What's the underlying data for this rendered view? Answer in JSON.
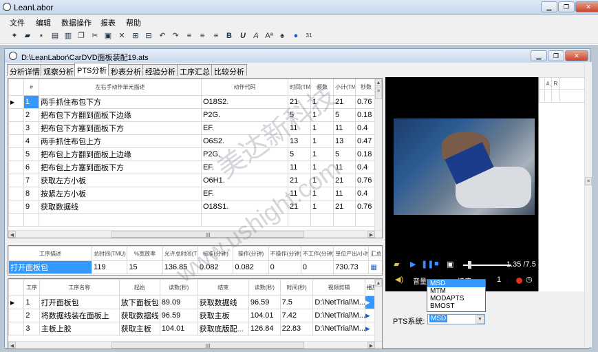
{
  "app": {
    "title": "LeanLabor"
  },
  "menu": [
    "文件",
    "编辑",
    "数据操作",
    "报表",
    "帮助"
  ],
  "toolbar_icons": [
    "new-icon",
    "open-icon",
    "save-icon",
    "print-preview-icon",
    "print-icon",
    "copy-icon",
    "cut-icon",
    "paste-icon",
    "delete-icon",
    "indent-icon",
    "outdent-icon",
    "undo-icon",
    "redo-icon",
    "align-left-icon",
    "align-center-icon",
    "align-right-icon",
    "bold-icon",
    "italic-icon",
    "font-icon",
    "font-color-icon",
    "find-icon",
    "help-icon",
    "calendar-icon"
  ],
  "document": {
    "title": "D:\\LeanLabor\\CarDVD面板装配19.ats"
  },
  "tabs": [
    "分析详情",
    "观察分析",
    "PTS分析",
    "秒表分析",
    "经验分析",
    "工序汇总",
    "比较分析"
  ],
  "active_tab": "PTS分析",
  "pts_table": {
    "headers": [
      "#",
      "左右手动作单元描述",
      "动作代码",
      "时间(TMU)",
      "频数",
      "小计(TMU)",
      "秒数"
    ],
    "rows": [
      [
        "1",
        "两手抓住布包下方",
        "O18S2.",
        "21",
        "1",
        "21",
        "0.76"
      ],
      [
        "2",
        "把布包下方翻到面板下边缘",
        "P2G.",
        "5",
        "1",
        "5",
        "0.18"
      ],
      [
        "3",
        "把布包下方塞到面板下方",
        "EF.",
        "11",
        "1",
        "11",
        "0.4"
      ],
      [
        "4",
        "两手抓住布包上方",
        "O6S2.",
        "13",
        "1",
        "13",
        "0.47"
      ],
      [
        "5",
        "把布包上方翻到面板上边缘",
        "P2G.",
        "5",
        "1",
        "5",
        "0.18"
      ],
      [
        "6",
        "把布包上方塞到面板下方",
        "EF.",
        "11",
        "1",
        "11",
        "0.4"
      ],
      [
        "7",
        "获取左方小板",
        "O6H1.",
        "21",
        "1",
        "21",
        "0.76"
      ],
      [
        "8",
        "按紧左方小板",
        "EF.",
        "11",
        "1",
        "11",
        "0.4"
      ],
      [
        "9",
        "获取数据线",
        "O18S1.",
        "21",
        "1",
        "21",
        "0.76"
      ]
    ],
    "hscroll": "III"
  },
  "summary_table": {
    "headers": [
      "工序描述",
      "总时间(TMU)",
      "%宽放率",
      "允许总时间(TMU)",
      "标准(分钟)",
      "操作(分钟)",
      "不操作(分钟)",
      "不工作(分钟)",
      "单位产出/小时",
      "汇总"
    ],
    "row": [
      "打开面板包",
      "119",
      "15",
      "136.85",
      "0.082",
      "0.082",
      "0",
      "0",
      "730.73"
    ]
  },
  "process_table": {
    "headers": [
      "工序",
      "工序名称",
      "起始",
      "读数(秒)",
      "结束",
      "读数(秒)",
      "时间(秒)",
      "视频剪辑",
      "播放"
    ],
    "rows": [
      [
        "1",
        "打开面板包",
        "放下面板包",
        "89.09",
        "获取数据线",
        "96.59",
        "7.5",
        "D:\\NetTrial\\M..."
      ],
      [
        "2",
        "将数据线装在面板上",
        "获取数据线",
        "96.59",
        "获取主板",
        "104.01",
        "7.42",
        "D:\\NetTrial\\M..."
      ],
      [
        "3",
        "主板上胶",
        "获取主板",
        "104.01",
        "获取底版配...",
        "126.84",
        "22.83",
        "D:\\NetTrial\\M..."
      ]
    ],
    "hscroll": "III"
  },
  "video": {
    "side_headers": [
      "#.",
      "R"
    ],
    "time": "1.35 /7.5",
    "volume_label": "音量:",
    "speed_label": "速度:",
    "speed_value": "1"
  },
  "pts": {
    "label": "PTS系统:",
    "selected": "MSD",
    "options": [
      "MSD",
      "MTM",
      "MODAPTS",
      "BMOST"
    ]
  },
  "watermark": {
    "line1": "美达新科技",
    "line2": "www.ushight.com"
  },
  "colors": {
    "selection": "#3399ff",
    "record_dot": "#e03020"
  }
}
